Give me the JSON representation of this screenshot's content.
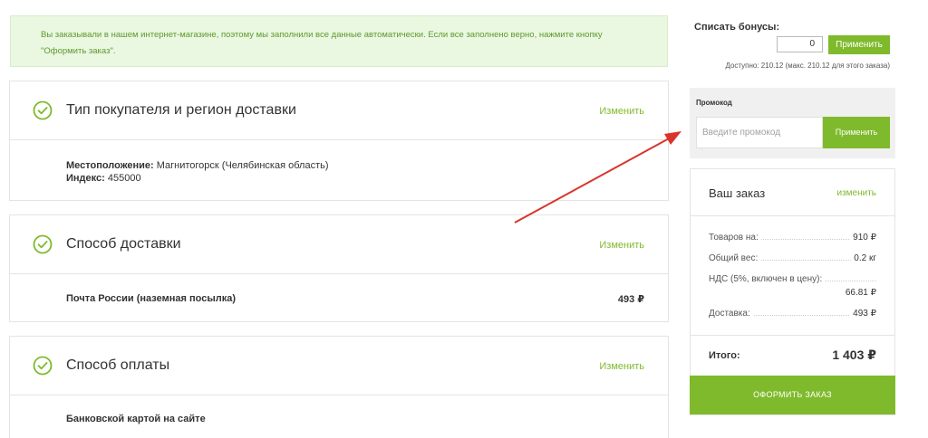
{
  "notice": {
    "line1": "Вы заказывали в нашем интернет-магазине, поэтому мы заполнили все данные автоматически. Если все заполнено верно, нажмите кнопку",
    "line2": "\"Оформить заказ\"."
  },
  "sections": [
    {
      "title": "Тип покупателя и регион доставки",
      "edit_label": "Изменить",
      "location_label": "Местоположение:",
      "location_value": " Магнитогорск (Челябинская область)",
      "index_label": "Индекс:",
      "index_value": " 455000"
    },
    {
      "title": "Способ доставки",
      "edit_label": "Изменить",
      "method": "Почта России (наземная посылка)",
      "price": "493 ₽"
    },
    {
      "title": "Способ оплаты",
      "edit_label": "Изменить",
      "method": "Банковской картой на сайте"
    }
  ],
  "bonus": {
    "title": "Списать бонусы:",
    "input_value": "0",
    "apply_label": "Применить",
    "available": "Доступно: 210.12 (макс. 210.12 для этого заказа)"
  },
  "promo": {
    "title": "Промокод",
    "placeholder": "Введите промокод",
    "apply_label": "Применить"
  },
  "order": {
    "title": "Ваш заказ",
    "edit_label": "изменить",
    "items_label": "Товаров на:",
    "items_value": "910 ₽",
    "weight_label": "Общий вес:",
    "weight_value": "0.2 кг",
    "vat_label": "НДС (5%, включен в цену):",
    "vat_value": "66.81 ₽",
    "delivery_label": "Доставка:",
    "delivery_value": "493 ₽",
    "total_label": "Итого:",
    "total_value": "1 403 ₽",
    "checkout_label": "ОФОРМИТЬ ЗАКАЗ"
  },
  "colors": {
    "accent": "#7fba2c",
    "notice_bg": "#eaf7e1",
    "annotation_arrow": "#d9342b"
  }
}
